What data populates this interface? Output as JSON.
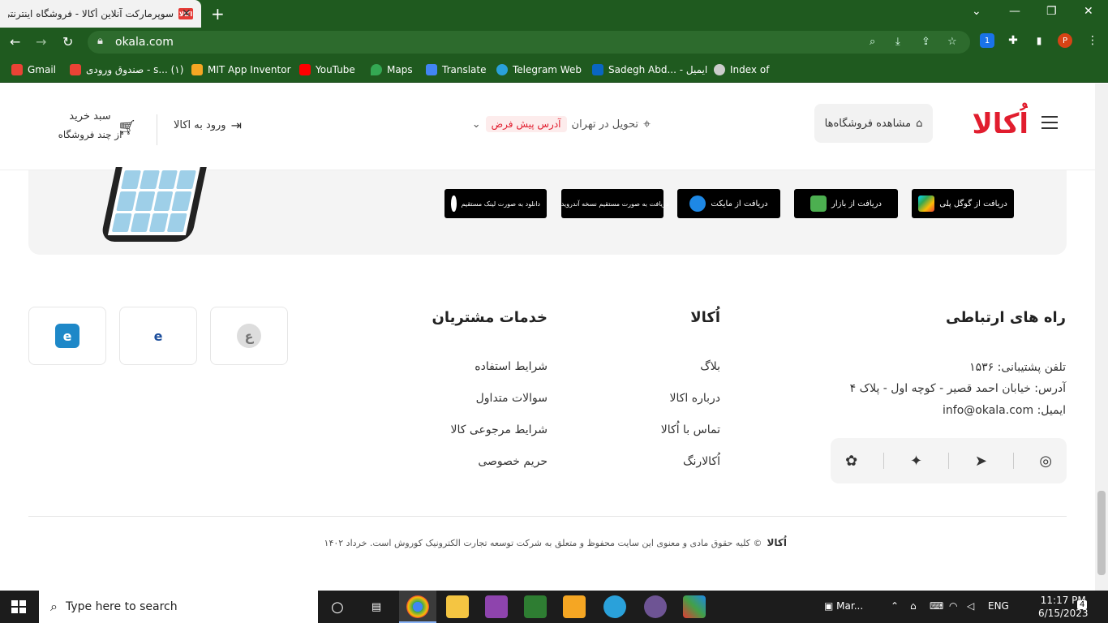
{
  "browser": {
    "tab_title": "سوپرمارکت آنلاین أکالا - فروشگاه اینترنتی",
    "tab_favicon": "اکالا",
    "new_tab": "+",
    "url": "okala.com",
    "profile_initial": "P",
    "ext_badge": "1"
  },
  "bookmarks": [
    {
      "label": "Gmail",
      "color": "#ea4335"
    },
    {
      "label": "صندوق ورودی - s... (۱)",
      "color": "#ea4335"
    },
    {
      "label": "MIT App Inventor",
      "color": "#f5a623"
    },
    {
      "label": "YouTube",
      "color": "#ff0000"
    },
    {
      "label": "Maps",
      "color": "#34a853"
    },
    {
      "label": "Translate",
      "color": "#4285f4"
    },
    {
      "label": "Telegram Web",
      "color": "#2aa1da"
    },
    {
      "label": "Sadegh Abd... - ایمیل",
      "color": "#0a66c2"
    },
    {
      "label": "Index of",
      "color": "#cccccc"
    }
  ],
  "header": {
    "logo": "اُکالا",
    "stores_button": "مشاهده فروشگاه‌ها",
    "delivery_prefix": "تحویل در تهران",
    "address_badge": "آدرس پیش فرض",
    "login": "ورود به اکالا",
    "cart_title": "سبد خرید",
    "cart_subtitle": "از چند فروشگاه"
  },
  "app_badges": [
    {
      "label": "دریافت از گوگل پلی",
      "icon": "google-play-icon",
      "color": "#34a853"
    },
    {
      "label": "دریافت از بازار",
      "icon": "bazaar-icon",
      "color": "#4caf50"
    },
    {
      "label": "دریافت از مایکت",
      "icon": "myket-icon",
      "color": "#1e88e5"
    },
    {
      "label": "دریافت به صورت مستقیم نسخه آندروید",
      "icon": "android-icon",
      "color": "#8bc34a"
    },
    {
      "label": "دانلود به صورت لینک مستقیم",
      "icon": "apple-icon",
      "color": "#ffffff"
    }
  ],
  "contact": {
    "title": "راه های ارتباطی",
    "phone": "تلفن پشتیبانی: ۱۵۳۶",
    "address": "آدرس: خیابان احمد قصیر - کوچه اول - پلاک ۴",
    "email": "ایمیل: info@okala.com"
  },
  "okala_col": {
    "title": "اُکالا",
    "links": [
      "بلاگ",
      "درباره اکالا",
      "تماس با اُکالا",
      "اُکالارنگ"
    ]
  },
  "services_col": {
    "title": "خدمات مشتریان",
    "links": [
      "شرایط استفاده",
      "سوالات متداول",
      "شرایط مرجوعی کالا",
      "حریم خصوصی"
    ]
  },
  "copyright": {
    "logo": "اُکالا",
    "text": "© کلیه حقوق مادی و معنوی این سایت محفوظ و متعلق به شرکت توسعه تجارت الکترونیک کوروش است.  خرداد ۱۴۰۲"
  },
  "taskbar": {
    "search_placeholder": "Type here to search",
    "task_label": "Mar...",
    "lang": "ENG",
    "time": "11:17 PM",
    "date": "6/15/2023",
    "notif_count": "4"
  }
}
